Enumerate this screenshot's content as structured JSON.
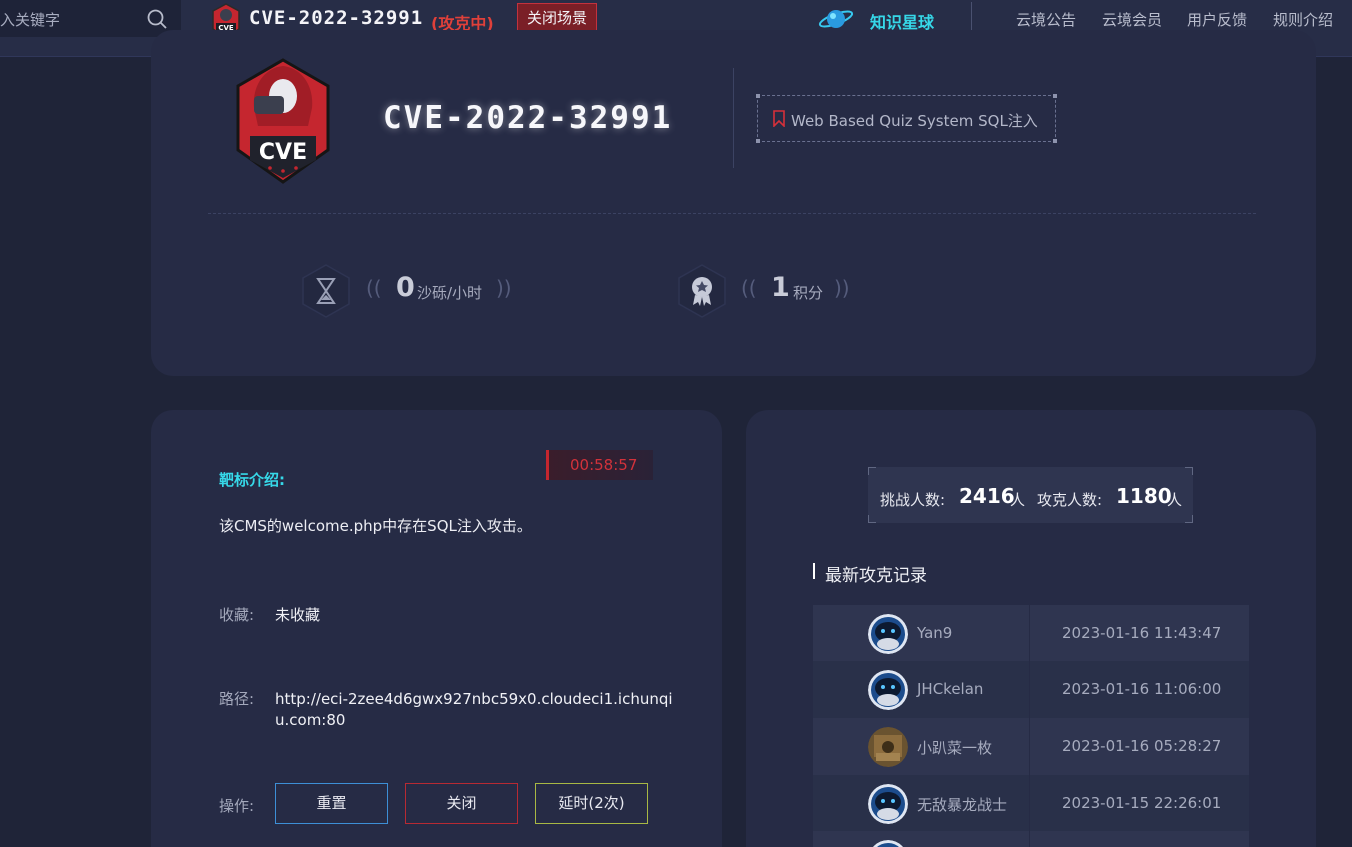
{
  "search": {
    "text": "入关键字"
  },
  "top": {
    "title": "CVE-2022-32991",
    "status": "(攻克中)",
    "close_scene": "关闭场景",
    "planet_label": "知识星球",
    "nav": [
      "云境公告",
      "云境会员",
      "用户反馈",
      "规则介绍"
    ]
  },
  "header": {
    "title": "CVE-2022-32991",
    "logo_text": "CVE",
    "tag": "Web Based Quiz System SQL注入",
    "stats": [
      {
        "value": "0",
        "unit": "沙砾/小时",
        "icon": "hourglass-icon"
      },
      {
        "value": "1",
        "unit": "积分",
        "icon": "medal-icon"
      }
    ]
  },
  "target": {
    "timer": "00:58:57",
    "label": "靶标介绍:",
    "desc": "该CMS的welcome.php中存在SQL注入攻击。",
    "fav_label": "收藏:",
    "fav_value": "未收藏",
    "path_label": "路径:",
    "path_value": "http://eci-2zee4d6gwx927nbc59x0.cloudeci1.ichunqiu.com:80",
    "op_label": "操作:",
    "buttons": [
      {
        "label": "重置",
        "color": "#3d8fd6"
      },
      {
        "label": "关闭",
        "color": "#b72a33"
      },
      {
        "label": "延时(2次)",
        "color": "#a8b844"
      }
    ]
  },
  "stats_panel": {
    "challengers_label": "挑战人数:",
    "challengers": "2416",
    "challengers_unit": "人",
    "solvers_label": "攻克人数:",
    "solvers": "1180",
    "solvers_unit": "人",
    "records_title": "最新攻克记录",
    "records": [
      {
        "name": "Yan9",
        "time": "2023-01-16 11:43:47",
        "avatar": "robot"
      },
      {
        "name": "JHCkelan",
        "time": "2023-01-16 11:06:00",
        "avatar": "robot"
      },
      {
        "name": "小趴菜一枚",
        "time": "2023-01-16 05:28:27",
        "avatar": "photo"
      },
      {
        "name": "无敌暴龙战士",
        "time": "2023-01-15 22:26:01",
        "avatar": "robot"
      },
      {
        "name": "",
        "time": "",
        "avatar": "robot"
      }
    ]
  },
  "colors": {
    "accent_cyan": "#36d8e8",
    "danger": "#c5262f",
    "bg": "#1f2438",
    "card": "#262b45"
  }
}
